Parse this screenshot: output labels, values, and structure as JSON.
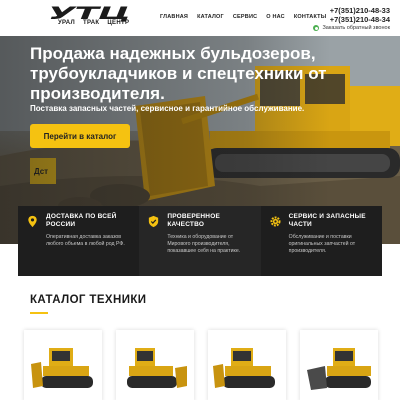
{
  "header": {
    "logo": {
      "word": "УТЦ",
      "sub": [
        "УРАЛ",
        "ТРАК",
        "ЦЕНТР"
      ]
    },
    "nav": [
      "ГЛАВНАЯ",
      "КАТАЛОГ",
      "СЕРВИС",
      "О НАС",
      "КОНТАКТЫ"
    ],
    "phones": [
      "+7(351)210-48-33",
      "+7(351)210-48-34"
    ],
    "callback": "Заказать обратный звонок"
  },
  "hero": {
    "title": "Продажа надежных бульдозеров, трубоукладчиков и спецтехники от производителя.",
    "subtitle": "Поставка запасных частей, сервисное и гарантийное обслуживание.",
    "button": "Перейти в каталог",
    "bg_colors": {
      "brand_yellow": "#f5c211"
    }
  },
  "features": [
    {
      "icon": "map-pin-icon",
      "title": "ДОСТАВКА ПО ВСЕЙ РОССИИ",
      "text": "Оперативная доставка заказов любого объема в любой род РФ."
    },
    {
      "icon": "shield-check-icon",
      "title": "ПРОВЕРЕННОЕ КАЧЕСТВО",
      "text": "Техника и оборудование от Мирового производителя, показавшее себя на практике."
    },
    {
      "icon": "gear-icon",
      "title": "СЕРВИС И ЗАПАСНЫЕ ЧАСТИ",
      "text": "Обслуживание и поставки оригинальных запчастей от производителя."
    }
  ],
  "catalog": {
    "title": "КАТАЛОГ ТЕХНИКИ",
    "products": [
      {
        "icon": "bulldozer-icon"
      },
      {
        "icon": "bulldozer-icon"
      },
      {
        "icon": "bulldozer-icon"
      },
      {
        "icon": "bulldozer-icon"
      }
    ]
  },
  "colors": {
    "accent": "#f5c211",
    "dark": "#1e1e1e",
    "text": "#222222"
  }
}
